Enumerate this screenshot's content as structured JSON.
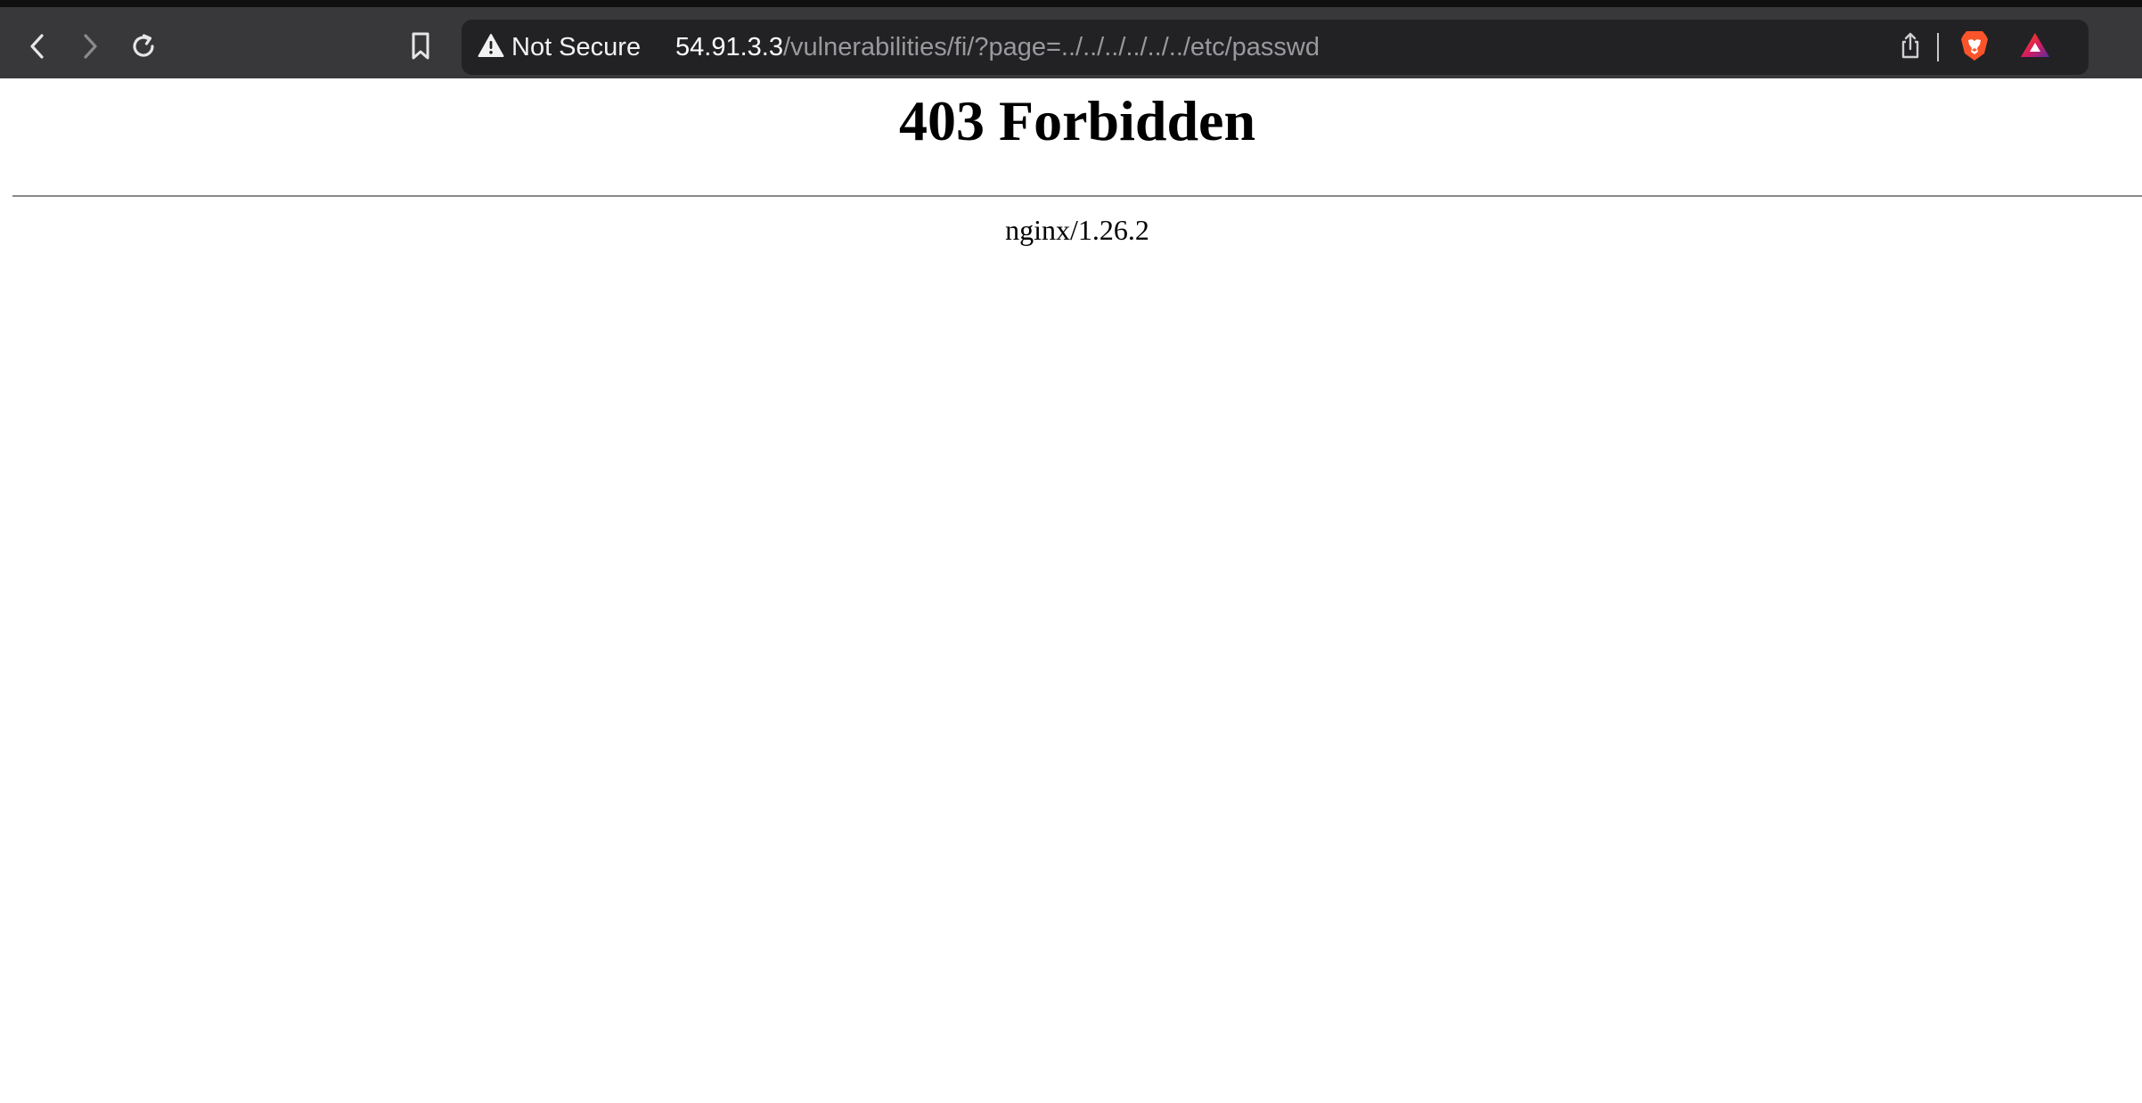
{
  "browser": {
    "security_label": "Not Secure",
    "url_host": "54.91.3.3",
    "url_path": "/vulnerabilities/fi/?page=../../../../../../etc/passwd",
    "icons": {
      "back": "chevron-left-icon",
      "forward": "chevron-right-icon",
      "reload": "reload-icon",
      "bookmark": "bookmark-icon",
      "warning": "warning-triangle-icon",
      "share": "share-icon",
      "brave_shields": "brave-lion-icon",
      "brave_rewards": "brave-rewards-triangle-icon"
    },
    "colors": {
      "toolbar_bg": "#38383a",
      "urlbar_bg": "#222225",
      "brave_orange": "#fb542b"
    }
  },
  "page": {
    "heading": "403 Forbidden",
    "server_signature": "nginx/1.26.2"
  }
}
